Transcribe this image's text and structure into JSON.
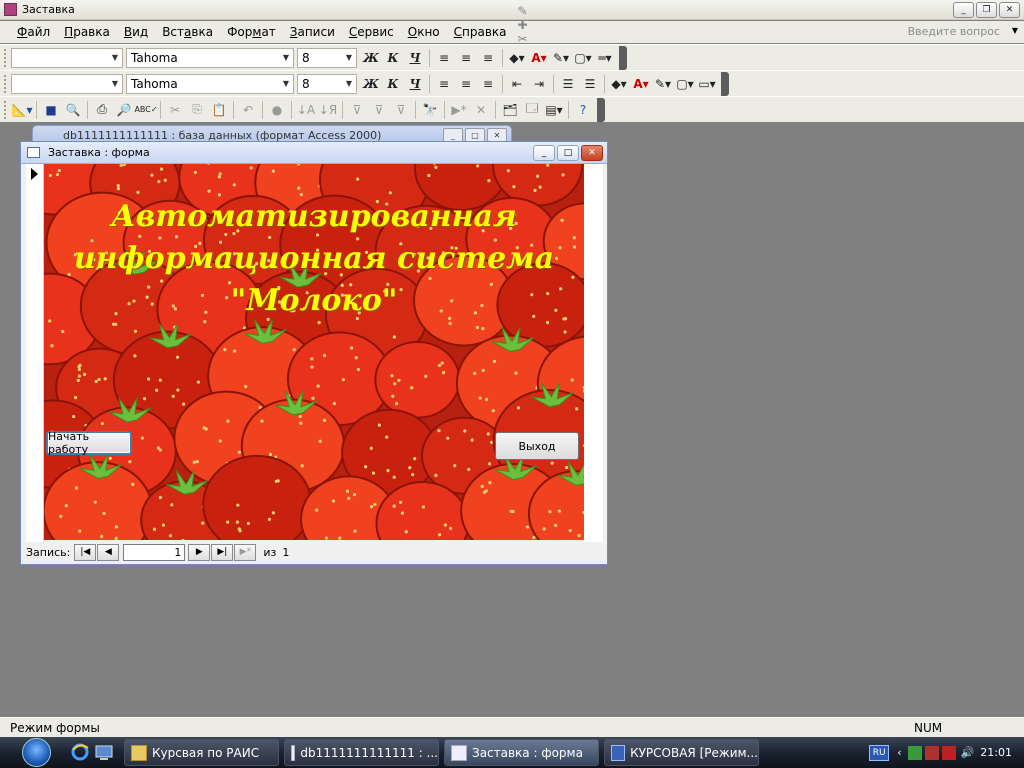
{
  "app": {
    "title": "Заставка"
  },
  "menubar": {
    "items": [
      {
        "prefix": "",
        "key": "Ф",
        "rest": "айл"
      },
      {
        "prefix": "",
        "key": "П",
        "rest": "равка"
      },
      {
        "prefix": "",
        "key": "В",
        "rest": "ид"
      },
      {
        "prefix": "Вст",
        "key": "а",
        "rest": "вка"
      },
      {
        "prefix": "Фор",
        "key": "м",
        "rest": "ат"
      },
      {
        "prefix": "",
        "key": "З",
        "rest": "аписи"
      },
      {
        "prefix": "",
        "key": "С",
        "rest": "ервис"
      },
      {
        "prefix": "",
        "key": "О",
        "rest": "кно"
      },
      {
        "prefix": "",
        "key": "С",
        "rest": "правка"
      }
    ],
    "ask_placeholder": "Введите вопрос"
  },
  "toolbar1": {
    "object_combo": "",
    "font": "Tahoma",
    "size": "8",
    "bold": "Ж",
    "italic": "К",
    "underline": "Ч"
  },
  "toolbar2": {
    "object_combo": "",
    "font": "Tahoma",
    "size": "8",
    "bold": "Ж",
    "italic": "К",
    "underline": "Ч"
  },
  "db_window": {
    "title": "db1111111111111 : база данных (формат Access 2000)"
  },
  "form": {
    "title": "Заставка : форма",
    "headline": [
      "Автоматизированная",
      "информационная система",
      "\"Молоко\""
    ],
    "start_button": "Начать работу",
    "exit_button": "Выход",
    "nav": {
      "label": "Запись:",
      "current": "1",
      "of_label": "из",
      "total": "1"
    }
  },
  "statusbar": {
    "mode": "Режим формы",
    "num": "NUM"
  },
  "taskbar": {
    "tasks": [
      {
        "label": "Курсвая по РАИС",
        "active": false
      },
      {
        "label": "db1111111111111 : ...",
        "active": false
      },
      {
        "label": "Заставка : форма",
        "active": true
      },
      {
        "label": "КУРСОВАЯ [Режим...",
        "active": false
      }
    ],
    "lang": "RU",
    "clock": "21:01"
  },
  "colors": {
    "headline": "#ffff00",
    "taskbar": "#1b2230",
    "mdi_background": "#808080"
  }
}
